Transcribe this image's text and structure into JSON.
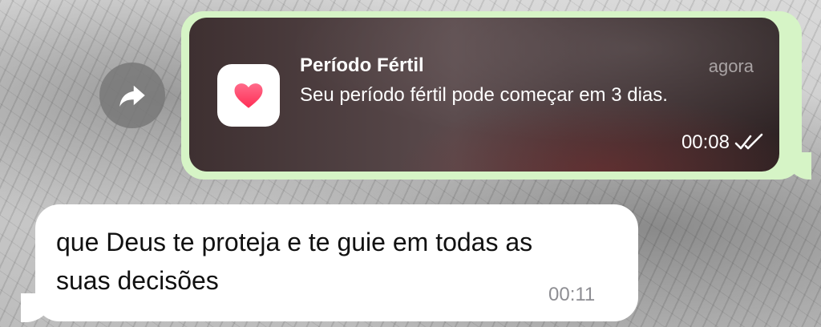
{
  "chat": {
    "forward_icon": "forward-arrow-icon",
    "sent_message": {
      "notification": {
        "app_icon": "heart-icon",
        "title": "Período Fértil",
        "time": "agora",
        "body": "Seu período fértil pode começar em 3 dias."
      },
      "time": "00:08",
      "status_icon": "double-check-icon"
    },
    "received_message": {
      "text": "que Deus te proteja e te guie em todas as suas decisões",
      "time": "00:11"
    }
  },
  "colors": {
    "sent_bubble": "#d6f4c6",
    "received_bubble": "#ffffff",
    "heart": "#ff2d55"
  }
}
